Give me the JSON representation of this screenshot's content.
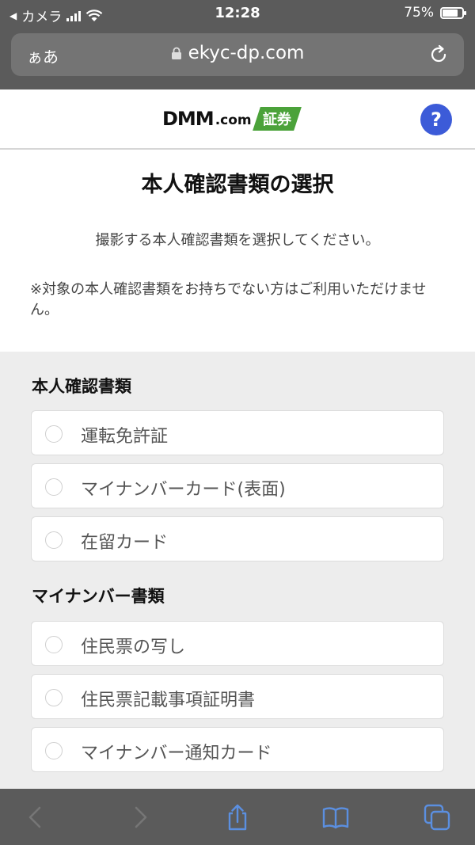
{
  "status_bar": {
    "carrier": "カメラ",
    "time": "12:28",
    "battery": "75%"
  },
  "browser": {
    "text_size_label": "ぁあ",
    "url": "ekyc-dp.com"
  },
  "header": {
    "logo_dmm": "DMM",
    "logo_com": ".com",
    "logo_suffix": "証券",
    "help_label": "?"
  },
  "page": {
    "title": "本人確認書類の選択",
    "subtitle": "撮影する本人確認書類を選択してください。",
    "note": "※対象の本人確認書類をお持ちでない方はご利用いただけません。"
  },
  "sections": [
    {
      "heading": "本人確認書類",
      "options": [
        {
          "label": "運転免許証"
        },
        {
          "label": "マイナンバーカード(表面)"
        },
        {
          "label": "在留カード"
        }
      ]
    },
    {
      "heading": "マイナンバー書類",
      "options": [
        {
          "label": "住民票の写し"
        },
        {
          "label": "住民票記載事項証明書"
        },
        {
          "label": "マイナンバー通知カード"
        }
      ]
    }
  ],
  "colors": {
    "help_button": "#3c5bd8",
    "logo_green": "#4ba23a"
  }
}
